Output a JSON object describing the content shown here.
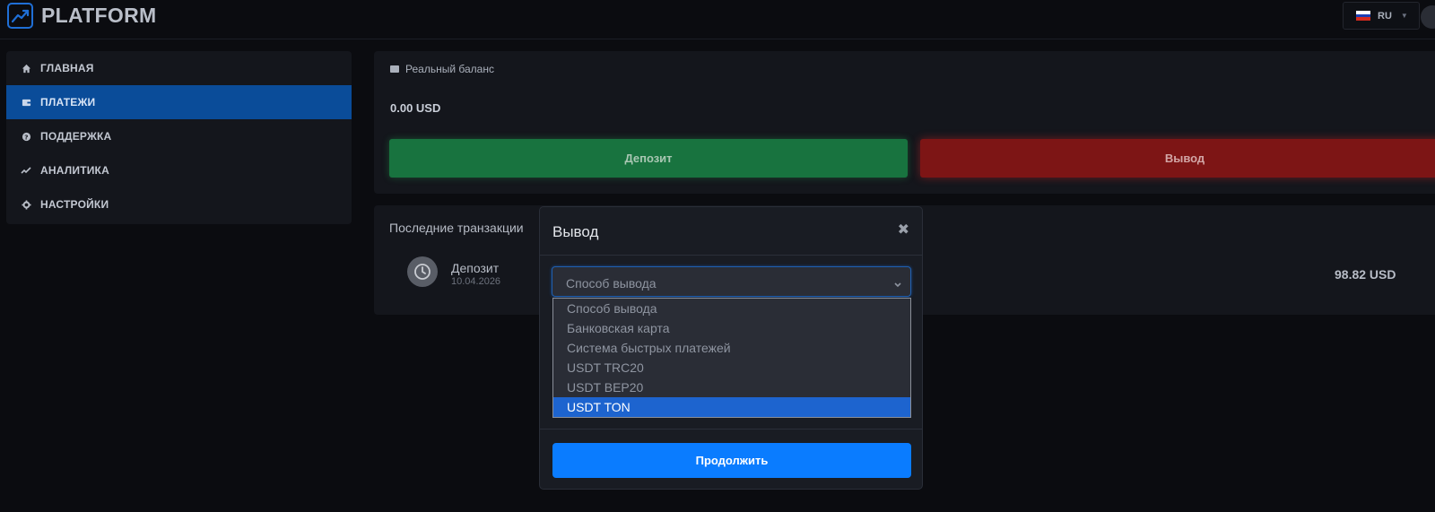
{
  "header": {
    "logo_text": "PLATFORM",
    "logo_icon": "trending-up-icon",
    "language": {
      "code": "RU",
      "flag": "russia-flag-icon"
    }
  },
  "sidebar": {
    "items": [
      {
        "label": "ГЛАВНАЯ",
        "icon": "home-icon",
        "active": false
      },
      {
        "label": "ПЛАТЕЖИ",
        "icon": "wallet-icon",
        "active": true
      },
      {
        "label": "ПОДДЕРЖКА",
        "icon": "question-circle-icon",
        "active": false
      },
      {
        "label": "АНАЛИТИКА",
        "icon": "chart-line-icon",
        "active": false
      },
      {
        "label": "НАСТРОЙКИ",
        "icon": "gear-icon",
        "active": false
      }
    ]
  },
  "balance": {
    "label": "Реальный баланс",
    "value": "0.00 USD",
    "deposit_label": "Депозит",
    "withdraw_label": "Вывод"
  },
  "transactions": {
    "title": "Последние транзакции",
    "items": [
      {
        "name": "Депозит",
        "date": "10.04.2026",
        "amount": "98.82 USD",
        "icon": "clock-icon"
      }
    ]
  },
  "modal": {
    "title": "Вывод",
    "select_value": "Способ вывода",
    "options": [
      "Способ вывода",
      "Банковская карта",
      "Система быстрых платежей",
      "USDT TRC20",
      "USDT BEP20",
      "USDT TON"
    ],
    "highlighted_option": "USDT TON",
    "continue_label": "Продолжить"
  },
  "colors": {
    "accent": "#0a7cff",
    "active_nav": "#0a4c99",
    "deposit": "#18733f",
    "withdraw": "#7d1515",
    "background": "#0b0c10"
  }
}
